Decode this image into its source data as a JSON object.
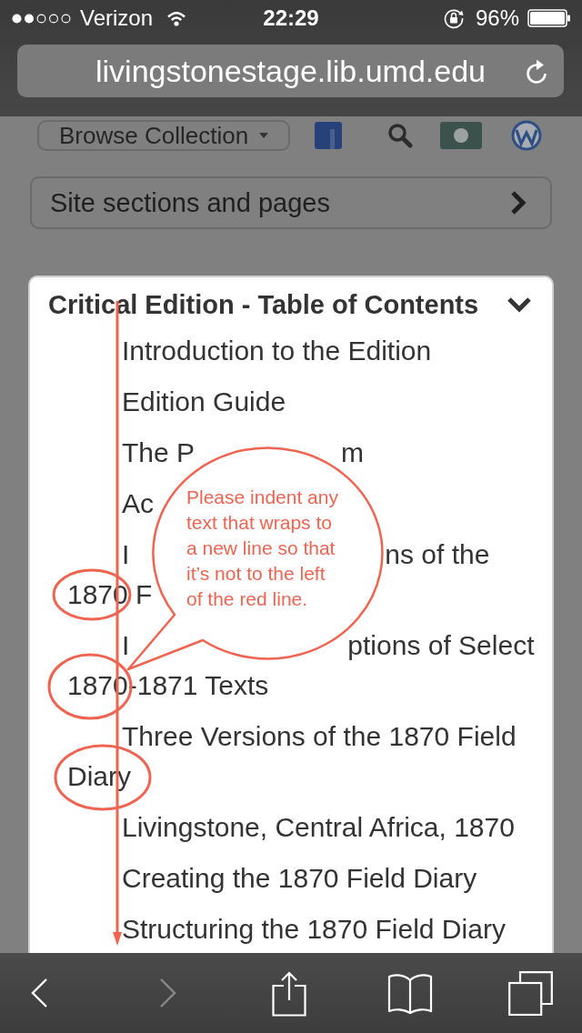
{
  "status_bar": {
    "carrier": "Verizon",
    "time": "22:29",
    "battery": "96%"
  },
  "address_bar": {
    "value": "livingstonestage.lib.umd.edu"
  },
  "page": {
    "browse_button": {
      "label": "Browse Collection"
    },
    "site_sections": {
      "label": "Site sections and pages",
      "expanded": false
    },
    "toc": {
      "title": "Critical Edition - Table of Contents",
      "expanded": true,
      "items": [
        {
          "text": "Introduction to the Edition"
        },
        {
          "text": "Edition Guide"
        },
        {
          "segments": [
            "The P",
            "m"
          ]
        },
        {
          "segments": [
            "Ac"
          ]
        },
        {
          "segments": [
            "I",
            "ns of the",
            "1870 F"
          ]
        },
        {
          "segments": [
            "I",
            "ptions of Select",
            "1870-1871 Texts"
          ]
        },
        {
          "text": "Three Versions of the 1870 Field Diary"
        },
        {
          "text": "Livingstone, Central Africa, 1870"
        },
        {
          "text": "Creating the 1870 Field Diary"
        },
        {
          "text": "Structuring the 1870 Field Diary"
        }
      ]
    }
  },
  "annotation": {
    "callout": "Please indent any\ntext that wraps to\na new line so that\nit’s not to the left\nof the red line."
  },
  "toolbar": [
    {
      "kind": "back",
      "disabled": false
    },
    {
      "kind": "forward",
      "disabled": true
    },
    {
      "kind": "share",
      "disabled": false
    },
    {
      "kind": "bookmarks",
      "disabled": false
    },
    {
      "kind": "tabs",
      "disabled": false
    }
  ]
}
